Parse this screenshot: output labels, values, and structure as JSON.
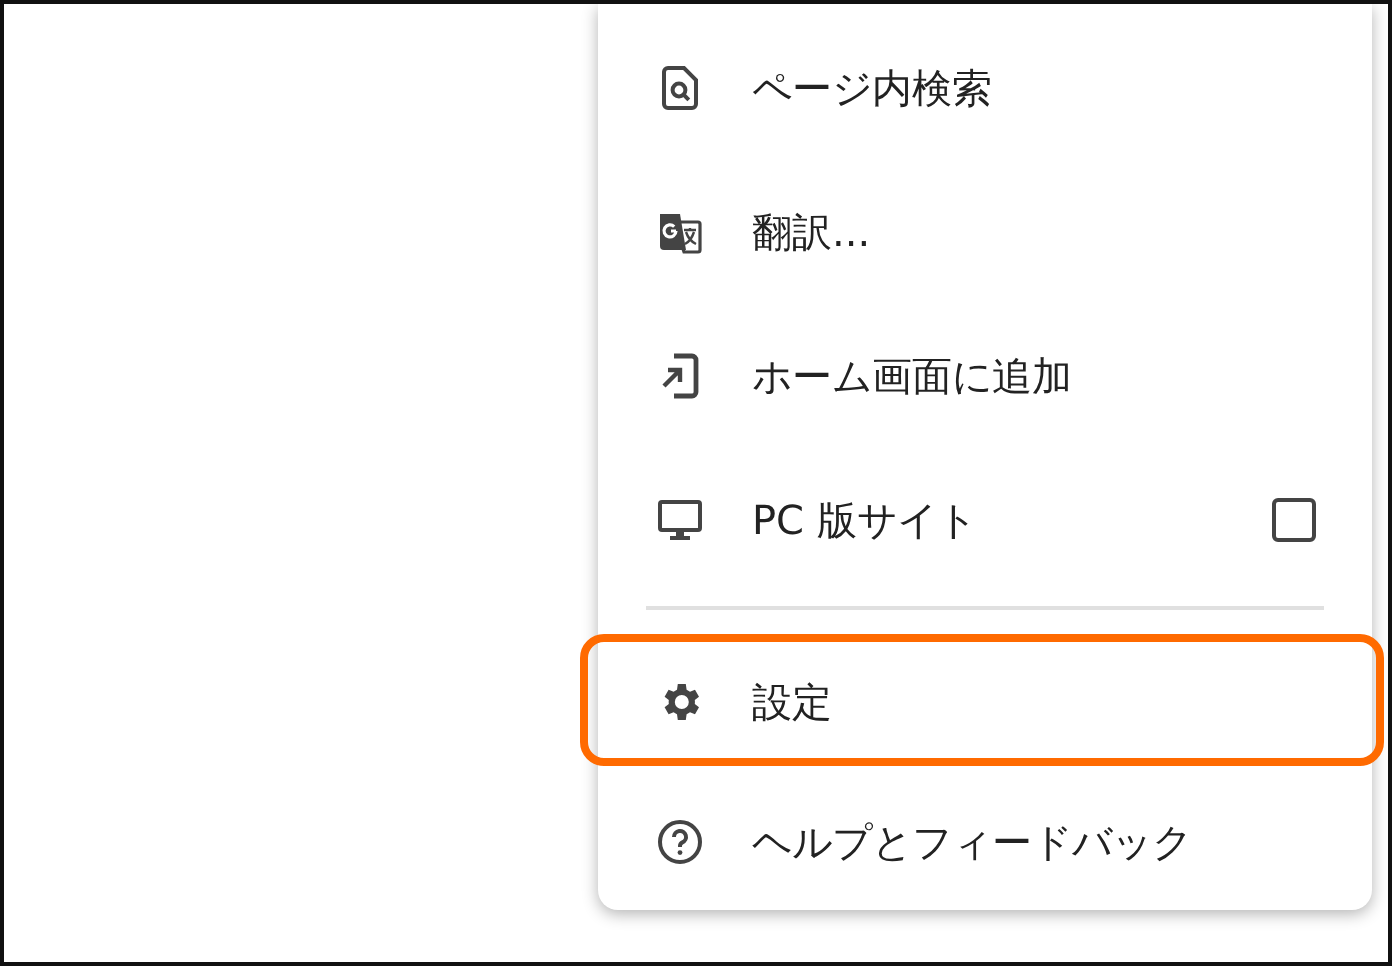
{
  "menu": {
    "items": [
      {
        "kind": "item",
        "label": "ページ内検索",
        "highlighted": false
      },
      {
        "kind": "item",
        "label": "翻訳...",
        "highlighted": false
      },
      {
        "kind": "item",
        "label": "ホーム画面に追加",
        "highlighted": false
      },
      {
        "kind": "checkbox",
        "label": "PC 版サイト",
        "checked": false,
        "highlighted": false
      },
      {
        "kind": "divider"
      },
      {
        "kind": "item",
        "label": "設定",
        "highlighted": true
      },
      {
        "kind": "item",
        "label": "ヘルプとフィードバック",
        "highlighted": false
      }
    ]
  }
}
